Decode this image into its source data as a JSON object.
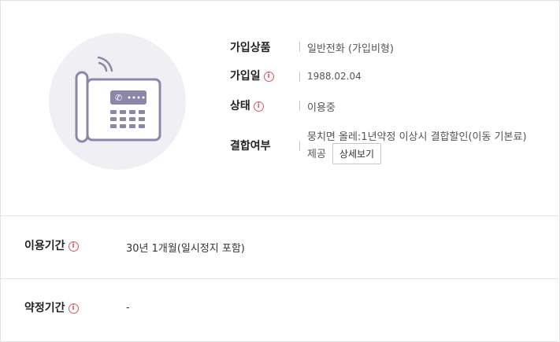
{
  "icons": {
    "phone": "telephone-icon",
    "info": "info-icon"
  },
  "colors": {
    "info_red": "#e05560",
    "icon_purple": "#8b87a8",
    "circle_bg": "#f0eff3"
  },
  "details": {
    "product": {
      "label": "가입상품",
      "value": "일반전화 (가입비형)"
    },
    "join_date": {
      "label": "가입일",
      "value": "1988.02.04"
    },
    "status": {
      "label": "상태",
      "value": "이용중"
    },
    "bundle": {
      "label": "결합여부",
      "value_line1": "뭉치면 올레:1년약정 이상시 결합할인(이동 기본료)",
      "value_line2": "제공",
      "detail_button": "상세보기"
    }
  },
  "usage_period": {
    "label": "이용기간",
    "value": "30년 1개월(일시정지 포함)"
  },
  "contract_period": {
    "label": "약정기간",
    "value": "-"
  },
  "info_symbol": "i"
}
